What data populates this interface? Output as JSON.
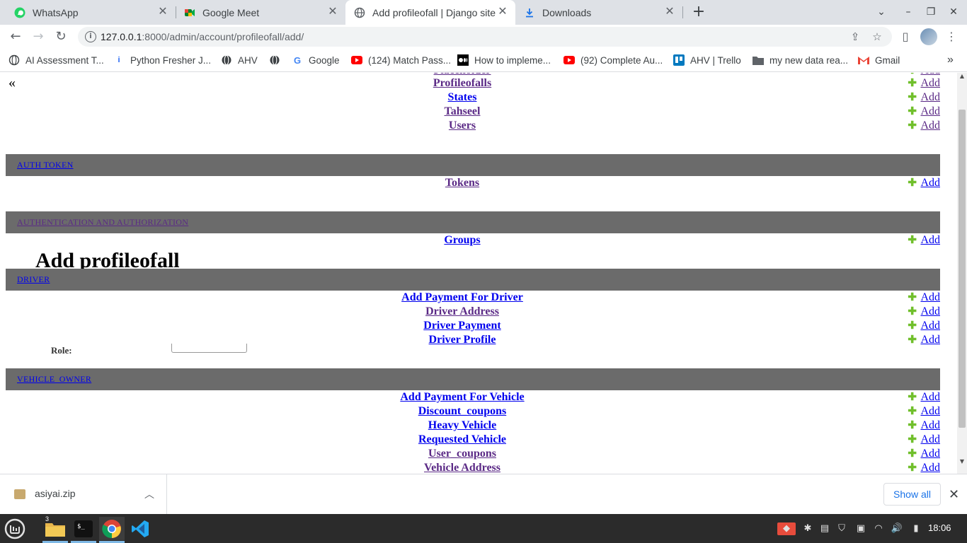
{
  "tabs": [
    {
      "label": "WhatsApp",
      "icon": "whatsapp-icon"
    },
    {
      "label": "Google Meet",
      "icon": "google-meet-icon"
    },
    {
      "label": "Add profileofall | Django site",
      "icon": "globe-icon"
    },
    {
      "label": "Downloads",
      "icon": "download-icon"
    }
  ],
  "address_bar": {
    "host": "127.0.0.1",
    "path": ":8000/admin/account/profileofall/add/"
  },
  "bookmarks": [
    {
      "label": "AI Assessment T...",
      "icon": "globe-icon"
    },
    {
      "label": "Python Fresher J...",
      "icon": "indeed-icon"
    },
    {
      "label": "AHV",
      "icon": "globe-icon"
    },
    {
      "label": "",
      "icon": "globe-icon"
    },
    {
      "label": "Google",
      "icon": "google-icon"
    },
    {
      "label": "(124) Match Pass...",
      "icon": "youtube-icon"
    },
    {
      "label": "How to impleme...",
      "icon": "medium-icon"
    },
    {
      "label": "(92) Complete Au...",
      "icon": "youtube-icon"
    },
    {
      "label": "AHV | Trello",
      "icon": "trello-icon"
    },
    {
      "label": "my new data rea...",
      "icon": "folder-icon"
    },
    {
      "label": "Gmail",
      "icon": "gmail-icon"
    }
  ],
  "page": {
    "collapse_label": "«",
    "background_title": "Add profileofall",
    "role_label": "Role:",
    "add_label": "Add",
    "account_models": [
      "Profileofalls",
      "States",
      "Tahseel",
      "Users"
    ],
    "sections": [
      {
        "title": "AUTH TOKEN",
        "models": [
          "Tokens"
        ]
      },
      {
        "title": "AUTHENTICATION AND AUTHORIZATION",
        "models": [
          "Groups"
        ]
      },
      {
        "title": "DRIVER",
        "models": [
          "Add Payment For Driver",
          "Driver Address",
          "Driver Payment",
          "Driver Profile"
        ]
      },
      {
        "title": "VEHICLE_OWNER",
        "models": [
          "Add Payment For Vehicle",
          "Discount_coupons",
          "Heavy Vehicle",
          "Requested Vehicle",
          "User_coupons",
          "Vehicle Address"
        ]
      }
    ]
  },
  "downloads": {
    "file": "asiyai.zip",
    "show_all": "Show all"
  },
  "taskbar": {
    "clock": "18:06",
    "files_badge": "3"
  },
  "colors": {
    "section_header": "#6b6b6b",
    "visited_link": "#5b2a86",
    "link": "#0000ee",
    "add_plus": "#70bf2b"
  }
}
